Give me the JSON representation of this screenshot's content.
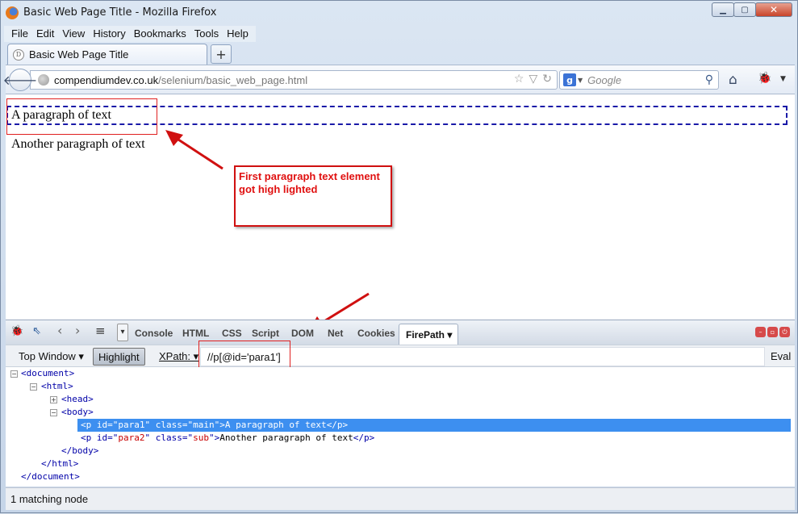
{
  "window": {
    "title": "Basic Web Page Title - Mozilla Firefox",
    "min_glyph": "▁",
    "max_glyph": "▢",
    "close_glyph": "✕"
  },
  "menubar": {
    "items": [
      "File",
      "Edit",
      "View",
      "History",
      "Bookmarks",
      "Tools",
      "Help"
    ]
  },
  "tabs": [
    {
      "label": "Basic Web Page Title",
      "icon": "D"
    }
  ],
  "new_tab_label": "+",
  "navbar": {
    "back_glyph": "🡐",
    "url_domain": "compendiumdev.co.uk",
    "url_path": "/selenium/basic_web_page.html",
    "url_icons": [
      "☆",
      "▽",
      "↻"
    ],
    "search_engine_letter": "g",
    "search_engine_drop": "▼",
    "search_placeholder": "Google",
    "search_glyph": "⚲",
    "home_glyph": "⌂",
    "firebug_glyph": "🐞",
    "firebug_drop": "▼"
  },
  "page": {
    "para1": "A paragraph of text",
    "para2": "Another paragraph of text",
    "annotation": "First paragraph text element got high lighted"
  },
  "firebug": {
    "tools": [
      "🐞",
      "⇖",
      "‹",
      "›",
      "≡",
      "▾"
    ],
    "tabs": [
      "Console",
      "HTML",
      "CSS",
      "Script",
      "DOM",
      "Net",
      "Cookies"
    ],
    "active_tab": "FirePath ▾",
    "win_btns": [
      "–",
      "▫",
      "⏻"
    ]
  },
  "firepath": {
    "top_window": "Top Window ▾",
    "highlight": "Highlight",
    "xpath_label": "XPath: ▾",
    "xpath_value": "//p[@id='para1']",
    "eval": "Eval"
  },
  "tree": {
    "collapse_glyph": "−",
    "expand_glyph": "+",
    "document_open": "<document>",
    "html_open": "<html>",
    "head": "<head>",
    "body_open": "<body>",
    "p1_open": "<p id=\"",
    "p1_id": "para1",
    "p1_mid": "\" class=\"",
    "p1_class": "main",
    "p1_close_tag": "\">",
    "p1_text": "A paragraph of text",
    "p_end": "</p>",
    "p2_open": "<p id=\"",
    "p2_id": "para2",
    "p2_mid": "\" class=\"",
    "p2_class": "sub",
    "p2_close_tag": "\">",
    "p2_text": "Another paragraph of text",
    "body_close": "</body>",
    "html_close": "</html>",
    "document_close": "</document>"
  },
  "status": {
    "text": "1 matching node"
  },
  "colors": {
    "highlight_border": "#1a1aa8",
    "annotation_red": "#e01010",
    "selected_row": "#3d8ff0"
  }
}
